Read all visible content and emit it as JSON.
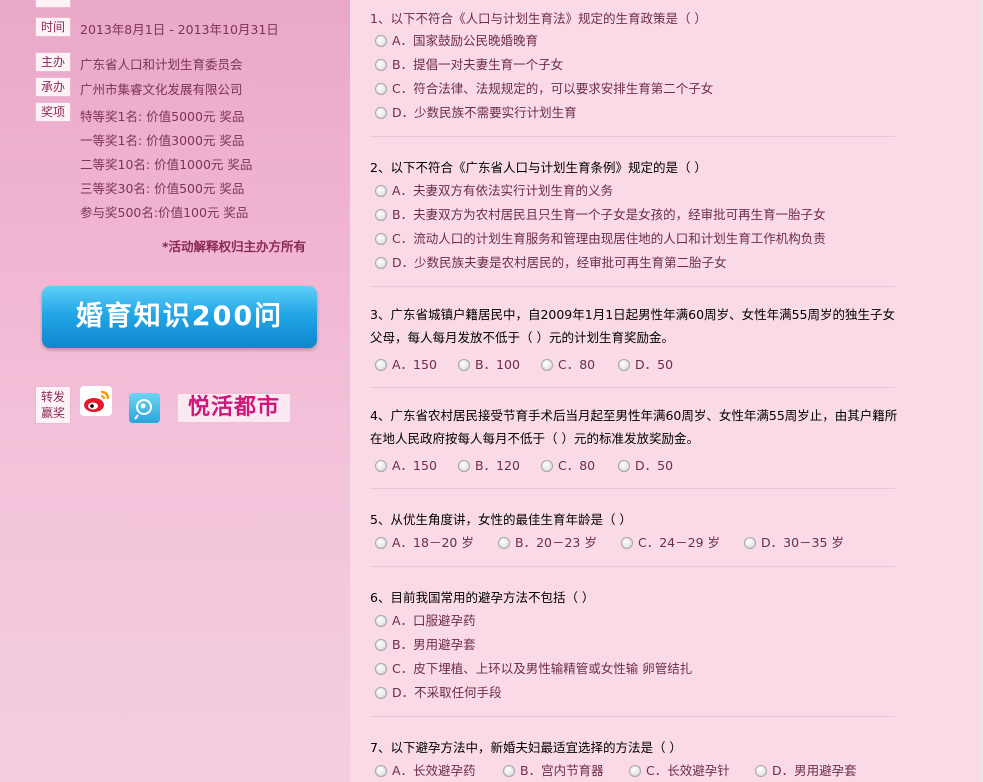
{
  "sidebar": {
    "time_label": "时间",
    "time_value": "2013年8月1日 - 2013年10月31日",
    "host_label": "主办",
    "host_value": "广东省人口和计划生育委员会",
    "organizer_label": "承办",
    "organizer_value": "广州市集睿文化发展有限公司",
    "prize_label": "奖项",
    "prizes": [
      "特等奖1名: 价值5000元 奖品",
      "一等奖1名: 价值3000元 奖品",
      "二等奖10名: 价值1000元 奖品",
      "三等奖30名: 价值500元 奖品",
      "参与奖500名:价值100元 奖品"
    ],
    "note": "*活动解释权归主办方所有",
    "banner_text": "婚育知识200问",
    "share_label": "转发赢奖",
    "share_icons": [
      "weibo-icon",
      "qq-weibo-icon"
    ],
    "city_logo": "悦活都市"
  },
  "questions": [
    {
      "title": "1、以下不符合《人口与计划生育法》规定的生育政策是（ ）",
      "options": [
        "A．国家鼓励公民晚婚晚育",
        "B．提倡一对夫妻生育一个子女",
        "C．符合法律、法规规定的，可以要求安排生育第二个子女",
        "D．少数民族不需要实行计划生育"
      ]
    },
    {
      "title": "2、以下不符合《广东省人口与计划生育条例》规定的是（ ）",
      "options": [
        "A．夫妻双方有依法实行计划生育的义务",
        "B．夫妻双方为农村居民且只生育一个子女是女孩的，经审批可再生育一胎子女",
        "C．流动人口的计划生育服务和管理由现居住地的人口和计划生育工作机构负责",
        "D．少数民族夫妻是农村居民的，经审批可再生育第二胎子女"
      ]
    },
    {
      "title": "3、广东省城镇户籍居民中，自2009年1月1日起男性年满60周岁、女性年满55周岁的独生子女父母，每人每月发放不低于（ ）元的计划生育奖励金。",
      "options": [
        "A．150",
        "B．100",
        "C．80",
        "D．50"
      ]
    },
    {
      "title": "4、广东省农村居民接受节育手术后当月起至男性年满60周岁、女性年满55周岁止，由其户籍所在地人民政府按每人每月不低于（ ）元的标准发放奖励金。",
      "options": [
        "A．150",
        "B．120",
        "C．80",
        "D．50"
      ]
    },
    {
      "title": "5、从优生角度讲，女性的最佳生育年龄是（ ）",
      "options": [
        "A．18－20 岁",
        "B．20－23 岁",
        "C．24－29 岁",
        "D．30－35 岁"
      ]
    },
    {
      "title": "6、目前我国常用的避孕方法不包括（ ）",
      "options": [
        "A．口服避孕药",
        "B．男用避孕套",
        "C．皮下埋植、上环以及男性输精管或女性输 卵管结扎",
        "D．不采取任何手段"
      ]
    },
    {
      "title": "7、以下避孕方法中，新婚夫妇最适宜选择的方法是（ ）",
      "options": [
        "A．长效避孕药",
        "B．宫内节育器",
        "C．长效避孕针",
        "D．男用避孕套"
      ]
    }
  ]
}
